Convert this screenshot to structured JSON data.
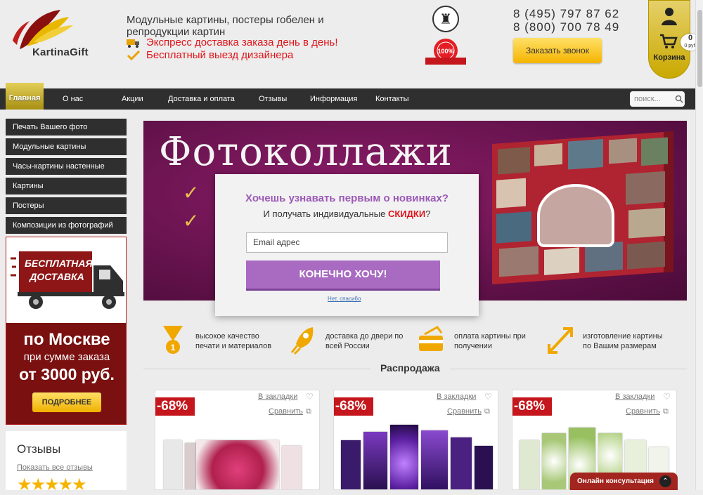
{
  "header": {
    "logo_text": "KartinaGift",
    "tagline": "Модульные картины, постеры гобелен и репродукции картин",
    "promo1": "Экспресс доставка заказа день в день!",
    "promo2": "Бесплатный выезд дизайнера",
    "phone1": "8 (495) 797 87 62",
    "phone2": "8 (800) 700 78 49",
    "callback_label": "Заказать звонок",
    "cart_label": "Корзина",
    "cart_count": "0",
    "cart_sum": "0 руб",
    "quality_badge": "100%"
  },
  "nav": {
    "items": [
      "Главная",
      "О нас",
      "Акции",
      "Доставка и оплата",
      "Отзывы",
      "Информация",
      "Контакты"
    ],
    "search_placeholder": "поиск..."
  },
  "sidebar": {
    "items": [
      "Печать Вашего фото",
      "Модульные картины",
      "Часы-картины настенные",
      "Картины",
      "Постеры",
      "Композиции из фотографий"
    ],
    "delivery": {
      "badge": "БЕСПЛАТНАЯ ДОСТАВКА",
      "city": "по Москве",
      "condition": "при сумме заказа",
      "amount": "от 3000 руб.",
      "button": "ПОДРОБНЕЕ"
    },
    "reviews": {
      "title": "Отзывы",
      "link": "Показать все отзывы",
      "stars": "★★★★★"
    }
  },
  "banner": {
    "title": "Фотоколлажи"
  },
  "modal": {
    "question": "Хочешь узнавать первым о новинках?",
    "sub_before": "И получать индивидуальные ",
    "sub_highlight": "СКИДКИ",
    "sub_after": "?",
    "email_placeholder": "Email адрес",
    "submit": "КОНЕЧНО ХОЧУ!",
    "decline": "Нет, спасибо"
  },
  "features": [
    {
      "icon": "medal-icon",
      "line1": "высокое качество",
      "line2": "печати и материалов"
    },
    {
      "icon": "rocket-icon",
      "line1": "доставка до двери по",
      "line2": "всей России"
    },
    {
      "icon": "payment-card-icon",
      "line1": "оплата картины при",
      "line2": "получении"
    },
    {
      "icon": "resize-arrows-icon",
      "line1": "изготовление картины",
      "line2": "по Вашим размерам"
    }
  ],
  "sale": {
    "title": "Распродажа",
    "products": [
      {
        "discount": "-68%",
        "bookmark": "В закладки",
        "compare": "Сравнить"
      },
      {
        "discount": "-68%",
        "bookmark": "В закладки",
        "compare": "Сравнить"
      },
      {
        "discount": "-68%",
        "bookmark": "В закладки",
        "compare": "Сравнить"
      }
    ]
  },
  "chat": {
    "label": "Онлайн консультация"
  },
  "colors": {
    "accent_gold": "#f5b400",
    "nav_dark": "#2f2f2f",
    "promo_red": "#e0141a",
    "modal_purple": "#a86bc1",
    "discount_red": "#c4161c"
  }
}
